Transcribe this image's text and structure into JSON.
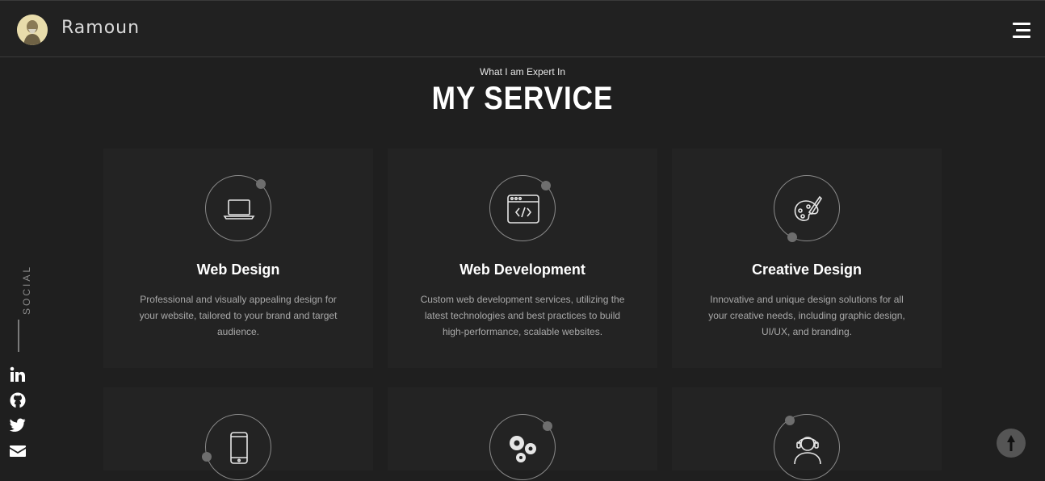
{
  "header": {
    "brand": "Ramoun",
    "avatar_icon": "avatar-portrait",
    "menu_icon": "hamburger-menu-icon"
  },
  "section": {
    "subtitle": "What I am Expert In",
    "title": "MY SERVICE"
  },
  "services": [
    {
      "icon": "laptop-icon",
      "title": "Web Design",
      "description": "Professional and visually appealing design for your website, tailored to your brand and target audience."
    },
    {
      "icon": "code-window-icon",
      "title": "Web Development",
      "description": "Custom web development services, utilizing the latest technologies and best practices to build high-performance, scalable websites."
    },
    {
      "icon": "palette-icon",
      "title": "Creative Design",
      "description": "Innovative and unique design solutions for all your creative needs, including graphic design, UI/UX, and branding."
    },
    {
      "icon": "mobile-phone-icon",
      "title": "",
      "description": ""
    },
    {
      "icon": "gears-icon",
      "title": "",
      "description": ""
    },
    {
      "icon": "support-agent-icon",
      "title": "",
      "description": ""
    }
  ],
  "social": {
    "label": "SOCIAL",
    "links": [
      "linkedin-icon",
      "github-icon",
      "twitter-icon",
      "envelope-icon"
    ]
  },
  "colors": {
    "background": "#1f1f1f",
    "card": "#232323",
    "text": "#ffffff",
    "muted": "#a8a8a8"
  }
}
